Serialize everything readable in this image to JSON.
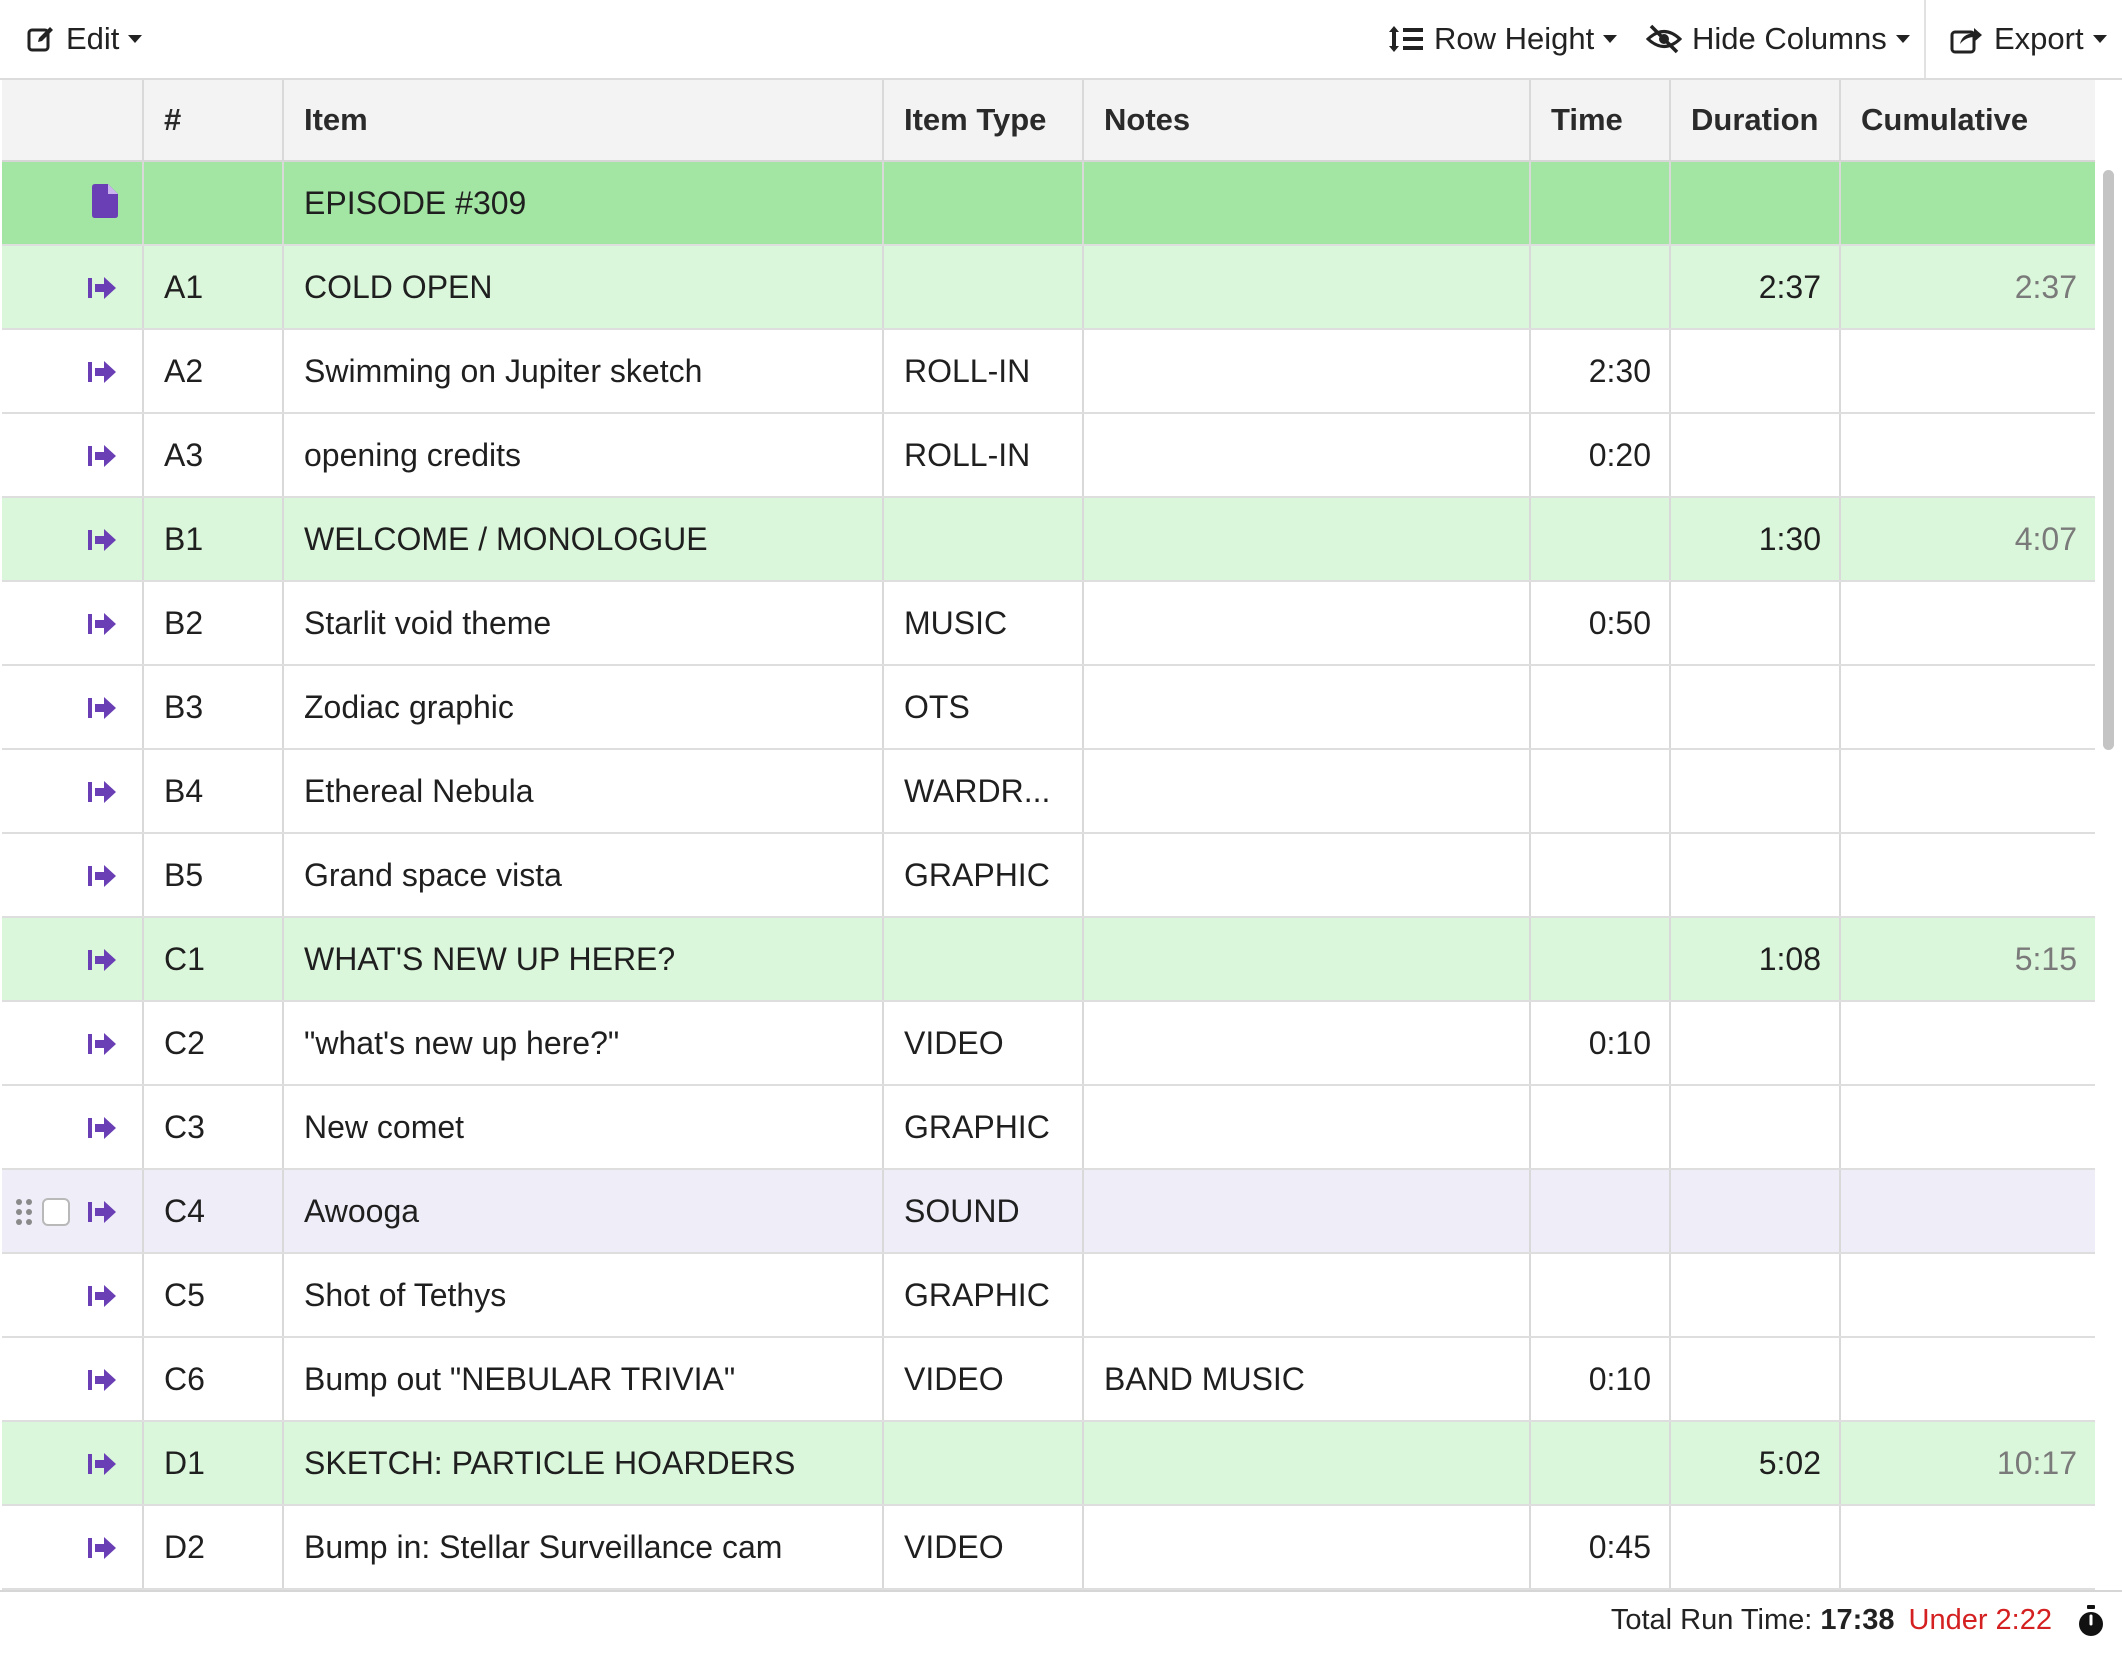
{
  "toolbar": {
    "edit_label": "Edit",
    "row_height_label": "Row Height",
    "hide_columns_label": "Hide Columns",
    "export_label": "Export",
    "icons": {
      "edit": "edit-icon",
      "row_height": "row-height-icon",
      "hide": "eye-slash-icon",
      "export": "export-icon"
    }
  },
  "columns": [
    "#",
    "Item",
    "Item Type",
    "Notes",
    "Time",
    "Duration",
    "Cumulative"
  ],
  "rows": [
    {
      "kind": "episode",
      "num": "",
      "item": "EPISODE #309",
      "type": "",
      "notes": "",
      "time": "",
      "duration": "",
      "cumulative": ""
    },
    {
      "kind": "segment",
      "num": "A1",
      "item": "COLD OPEN",
      "type": "",
      "notes": "",
      "time": "",
      "duration": "2:37",
      "cumulative": "2:37"
    },
    {
      "kind": "item",
      "num": "A2",
      "item": "Swimming on Jupiter sketch",
      "type": "ROLL-IN",
      "notes": "",
      "time": "2:30",
      "duration": "",
      "cumulative": ""
    },
    {
      "kind": "item",
      "num": "A3",
      "item": "opening credits",
      "type": "ROLL-IN",
      "notes": "",
      "time": "0:20",
      "duration": "",
      "cumulative": ""
    },
    {
      "kind": "segment",
      "num": "B1",
      "item": "WELCOME / MONOLOGUE",
      "type": "",
      "notes": "",
      "time": "",
      "duration": "1:30",
      "cumulative": "4:07"
    },
    {
      "kind": "item",
      "num": "B2",
      "item": "Starlit void theme",
      "type": "MUSIC",
      "notes": "",
      "time": "0:50",
      "duration": "",
      "cumulative": ""
    },
    {
      "kind": "item",
      "num": "B3",
      "item": "Zodiac graphic",
      "type": "OTS",
      "notes": "",
      "time": "",
      "duration": "",
      "cumulative": ""
    },
    {
      "kind": "item",
      "num": "B4",
      "item": "Ethereal Nebula",
      "type": "WARDR...",
      "notes": "",
      "time": "",
      "duration": "",
      "cumulative": ""
    },
    {
      "kind": "item",
      "num": "B5",
      "item": "Grand space vista",
      "type": "GRAPHIC",
      "notes": "",
      "time": "",
      "duration": "",
      "cumulative": ""
    },
    {
      "kind": "segment",
      "num": "C1",
      "item": "WHAT'S NEW UP HERE?",
      "type": "",
      "notes": "",
      "time": "",
      "duration": "1:08",
      "cumulative": "5:15"
    },
    {
      "kind": "item",
      "num": "C2",
      "item": "\"what's new up here?\"",
      "type": "VIDEO",
      "notes": "",
      "time": "0:10",
      "duration": "",
      "cumulative": ""
    },
    {
      "kind": "item",
      "num": "C3",
      "item": "New comet",
      "type": "GRAPHIC",
      "notes": "",
      "time": "",
      "duration": "",
      "cumulative": ""
    },
    {
      "kind": "hover",
      "num": "C4",
      "item": "Awooga",
      "type": "SOUND",
      "notes": "",
      "time": "",
      "duration": "",
      "cumulative": ""
    },
    {
      "kind": "item",
      "num": "C5",
      "item": "Shot of Tethys",
      "type": "GRAPHIC",
      "notes": "",
      "time": "",
      "duration": "",
      "cumulative": ""
    },
    {
      "kind": "item",
      "num": "C6",
      "item": "Bump out \"NEBULAR TRIVIA\"",
      "type": "VIDEO",
      "notes": "BAND MUSIC",
      "time": "0:10",
      "duration": "",
      "cumulative": ""
    },
    {
      "kind": "segment",
      "num": "D1",
      "item": "SKETCH: PARTICLE HOARDERS",
      "type": "",
      "notes": "",
      "time": "",
      "duration": "5:02",
      "cumulative": "10:17"
    },
    {
      "kind": "item",
      "num": "D2",
      "item": "Bump in: Stellar Surveillance cam",
      "type": "VIDEO",
      "notes": "",
      "time": "0:45",
      "duration": "",
      "cumulative": ""
    }
  ],
  "footer": {
    "label": "Total Run Time:",
    "value": "17:38",
    "under": "Under 2:22",
    "icon": "stopwatch-icon"
  },
  "colors": {
    "episode_row": "#a3e6a3",
    "segment_row": "#dbf7db",
    "hover_row": "#efedf8",
    "row_icon": "#6a3fb5",
    "under_text": "#d42020"
  }
}
